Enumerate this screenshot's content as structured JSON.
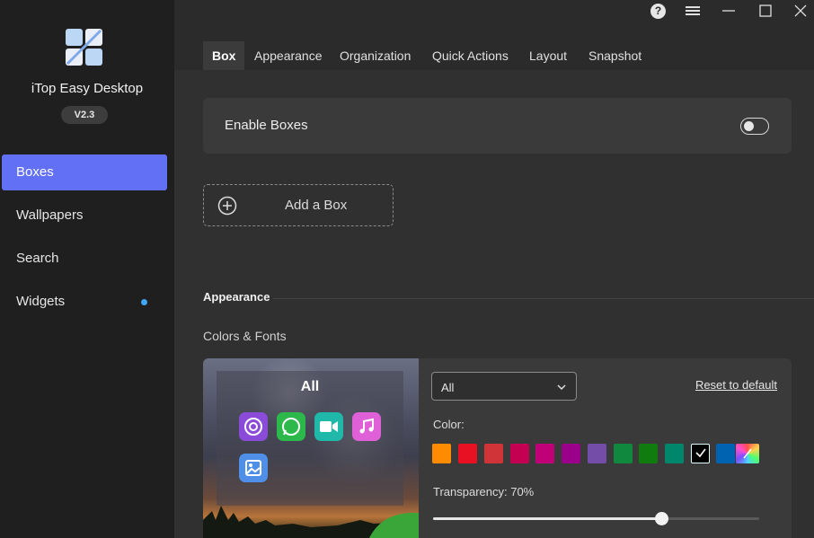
{
  "app": {
    "name": "iTop Easy Desktop",
    "version": "V2.3",
    "brand_color": "#6270f6"
  },
  "sidebar": {
    "items": [
      {
        "label": "Boxes",
        "active": true
      },
      {
        "label": "Wallpapers",
        "active": false
      },
      {
        "label": "Search",
        "active": false
      },
      {
        "label": "Widgets",
        "active": false,
        "dot_color": "#3fa7f5"
      }
    ]
  },
  "titlebar": {
    "help_glyph": "?",
    "icons": [
      "help-icon",
      "menu-icon",
      "minimize-icon",
      "maximize-icon",
      "close-icon"
    ]
  },
  "tabs": [
    {
      "label": "Box",
      "active": true
    },
    {
      "label": "Appearance",
      "active": false
    },
    {
      "label": "Organization",
      "active": false
    },
    {
      "label": "Quick Actions",
      "active": false
    },
    {
      "label": "Layout",
      "active": false
    },
    {
      "label": "Snapshot",
      "active": false
    }
  ],
  "box": {
    "enable_label": "Enable Boxes",
    "enable_on": false,
    "add_label": "Add a Box"
  },
  "appearance": {
    "section_title": "Appearance",
    "subsection": "Colors & Fonts",
    "preview_title": "All",
    "preview_apps": [
      "chrome-icon",
      "whatsapp-icon",
      "facetime-icon",
      "music-icon",
      "photos-icon"
    ],
    "select_value": "All",
    "reset_label": "Reset to default",
    "color_label": "Color:",
    "colors": [
      "#ff8c00",
      "#e81123",
      "#d13438",
      "#c30052",
      "#bf0077",
      "#9a0089",
      "#744da9",
      "#10893e",
      "#107c10",
      "#00866b",
      "#000000",
      "#0063b1",
      "rainbow"
    ],
    "selected_color": "#000000",
    "transparency_label": "Transparency: 70%",
    "transparency": 0.7
  }
}
